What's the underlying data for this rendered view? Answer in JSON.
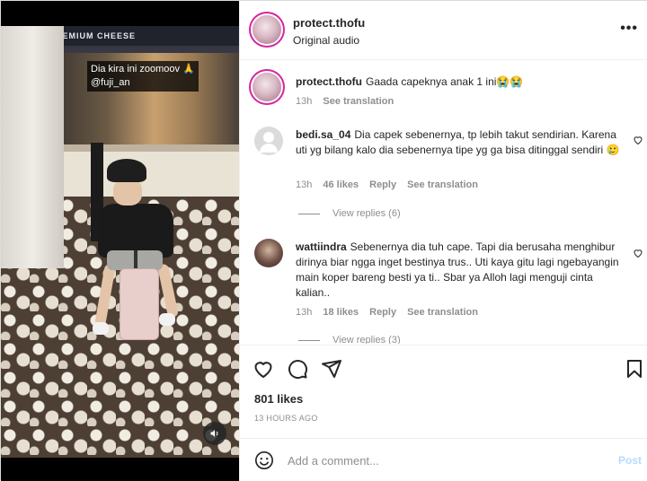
{
  "media": {
    "banner_text": "PREMIUM    CHEESE",
    "caption_line1": "Dia kira ini zoomoov 🙏",
    "caption_line2": "@fuji_an"
  },
  "header": {
    "username": "protect.thofu",
    "audio": "Original audio",
    "more": "•••"
  },
  "post_caption": {
    "username": "protect.thofu",
    "text": "Gaada capeknya anak 1 ini😭😭",
    "time": "13h",
    "see_translation": "See translation"
  },
  "comments": [
    {
      "username": "bedi.sa_04",
      "text": "Dia capek sebenernya, tp lebih takut sendirian. Karena uti yg bilang kalo dia sebenernya tipe yg ga bisa ditinggal sendiri 🥲",
      "time": "13h",
      "likes": "46 likes",
      "reply": "Reply",
      "see_translation": "See translation",
      "view_replies": "View replies (6)"
    },
    {
      "username": "wattiindra",
      "text": "Sebenernya dia tuh cape. Tapi dia berusaha menghibur dirinya biar ngga inget bestinya trus.. Uti kaya gitu lagi ngebayangin main koper bareng besti ya ti.. Sbar ya Alloh lagi menguji cinta kalian..",
      "time": "13h",
      "likes": "18 likes",
      "reply": "Reply",
      "see_translation": "See translation",
      "view_replies": "View replies (3)"
    }
  ],
  "stats": {
    "likes": "801 likes",
    "posted": "13 HOURS AGO"
  },
  "add_comment": {
    "placeholder": "Add a comment...",
    "post": "Post"
  },
  "icons": [
    "heart-icon",
    "comment-icon",
    "share-icon",
    "bookmark-icon",
    "emoji-icon",
    "volume-icon",
    "more-icon"
  ]
}
